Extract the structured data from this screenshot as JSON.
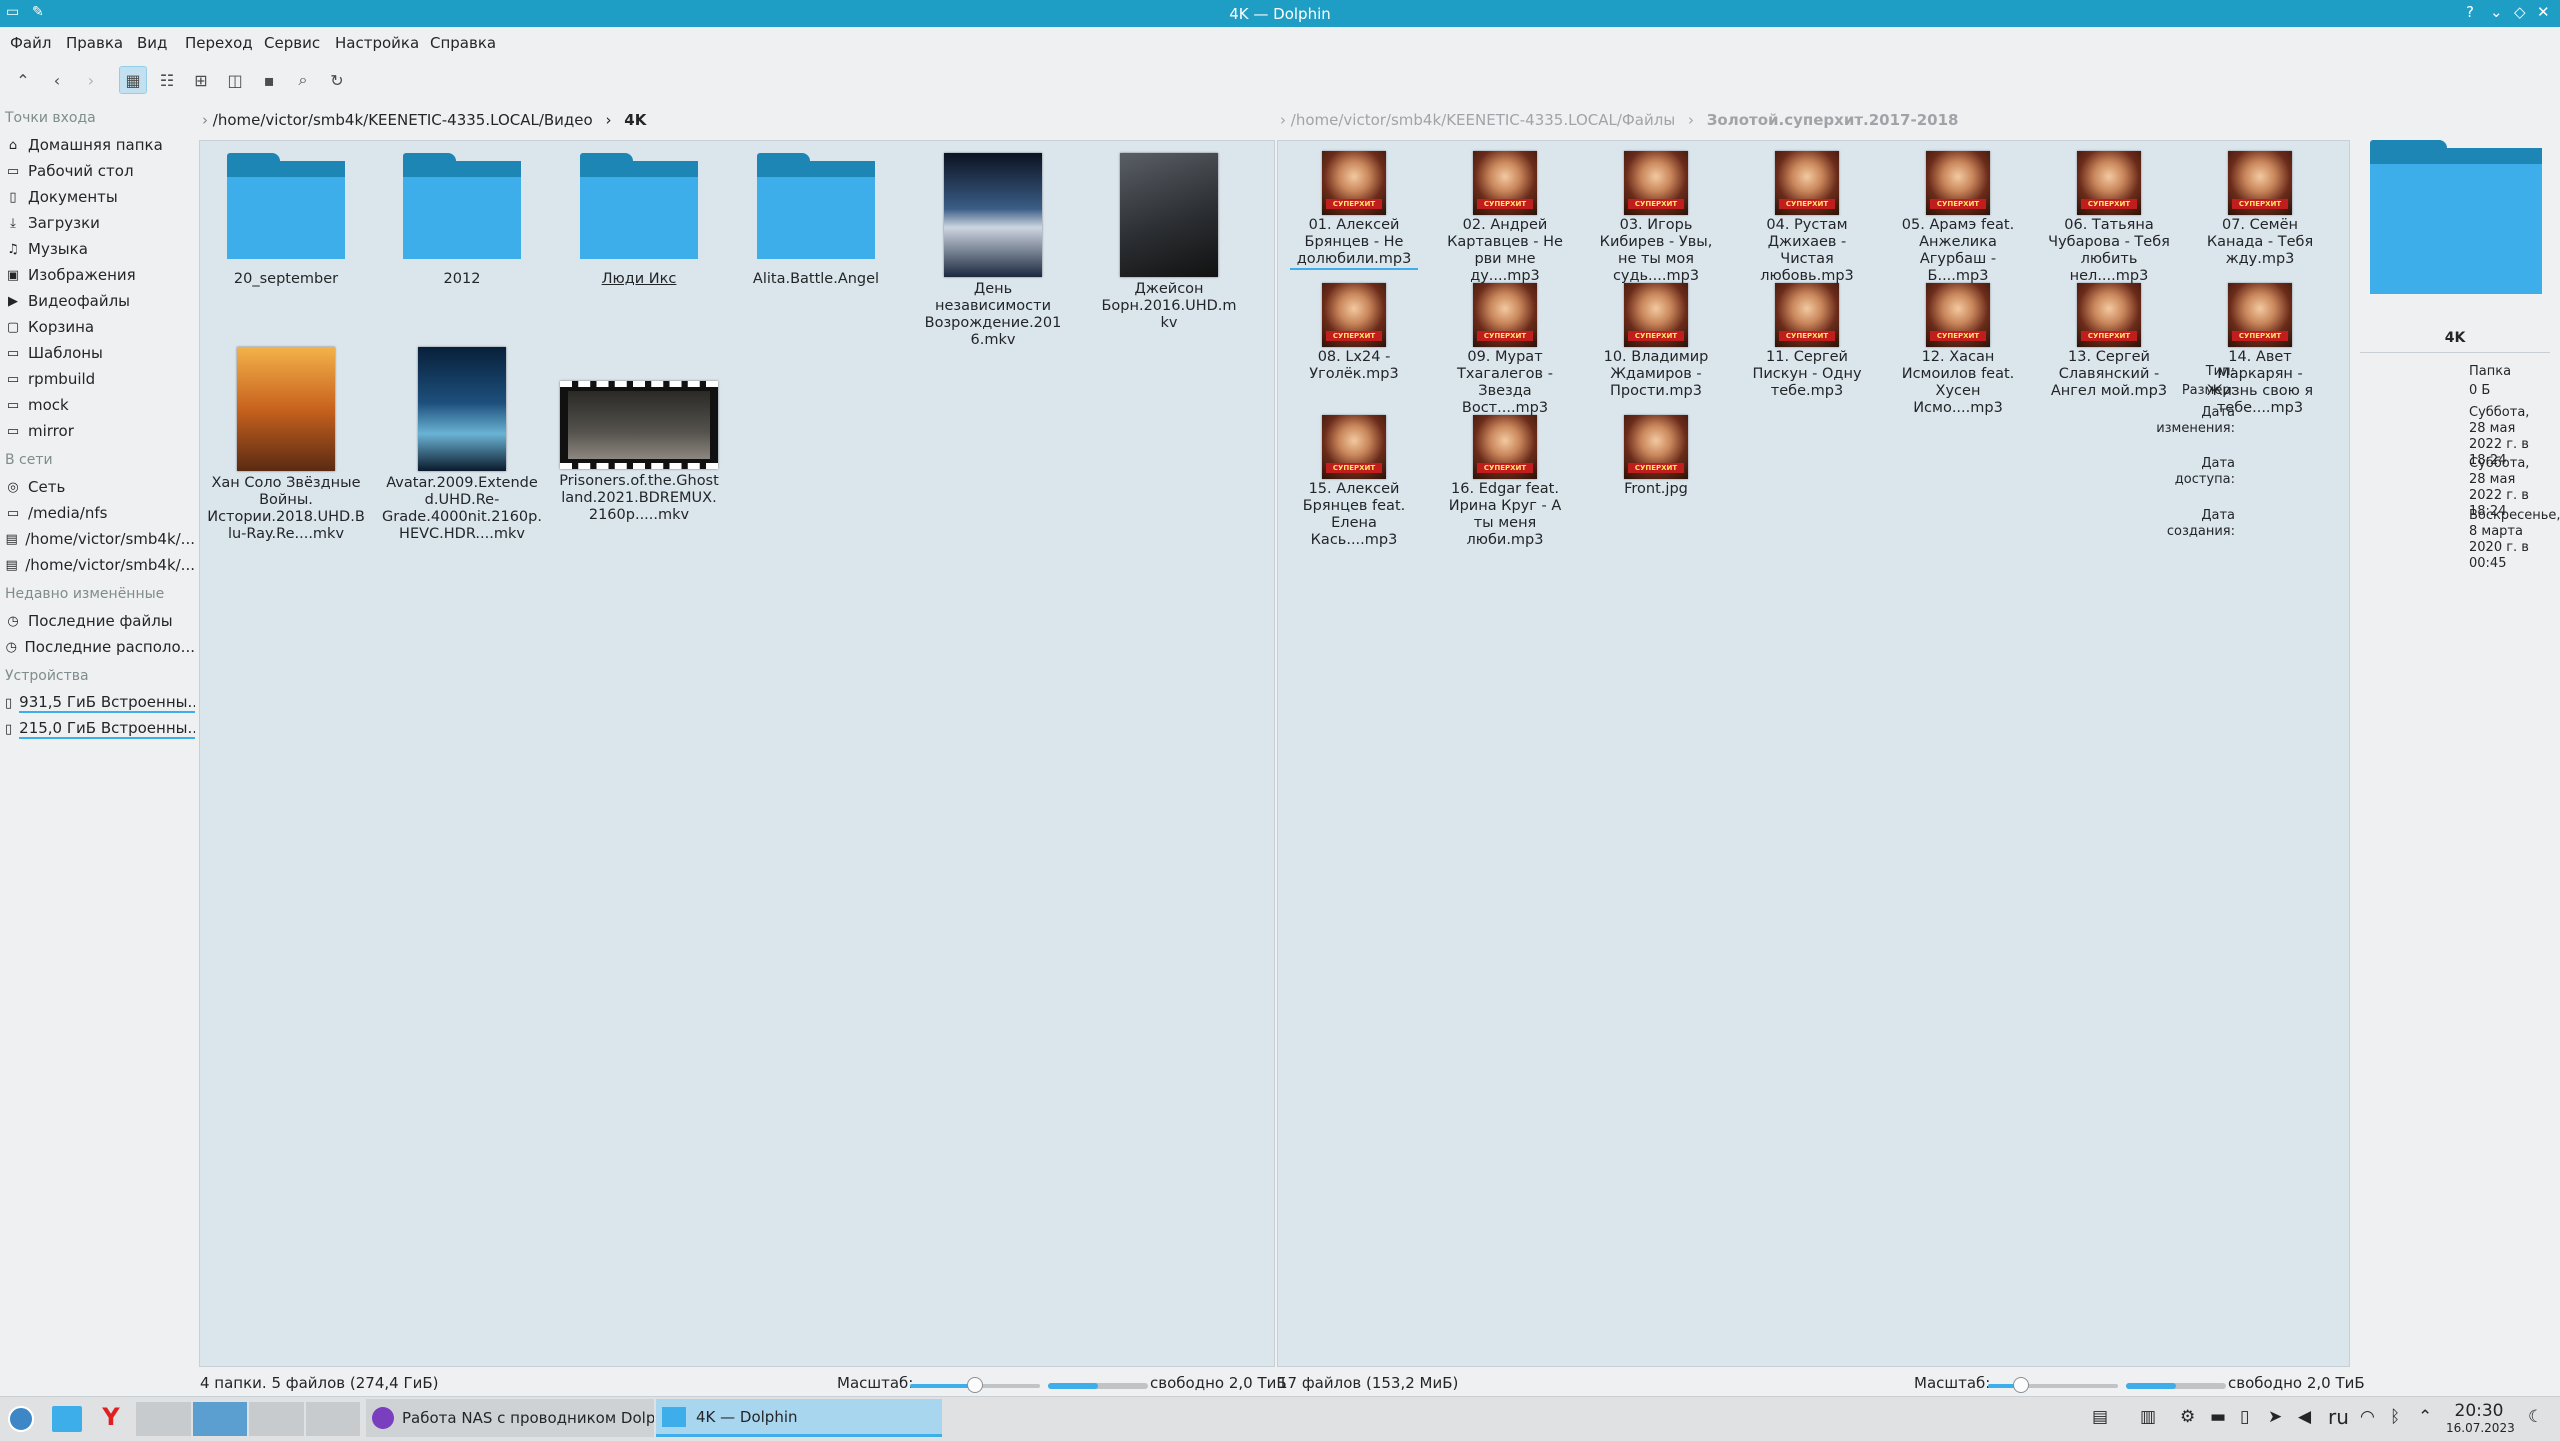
{
  "window": {
    "title": "4K — Dolphin"
  },
  "menu": [
    "Файл",
    "Правка",
    "Вид",
    "Переход",
    "Сервис",
    "Настройка",
    "Справка"
  ],
  "toolbar": {
    "icons": [
      "up-arrow-icon",
      "back-arrow-icon",
      "forward-arrow-icon",
      "icons-view-icon",
      "details-view-icon",
      "compact-view-icon",
      "split-view-icon",
      "terminal-icon",
      "search-icon",
      "refresh-icon"
    ]
  },
  "places": {
    "sections": [
      {
        "title": "Точки входа",
        "items": [
          "Домашняя папка",
          "Рабочий стол",
          "Документы",
          "Загрузки",
          "Музыка",
          "Изображения",
          "Видеофайлы",
          "Корзина",
          "Шаблоны",
          "rpmbuild",
          "mock",
          "mirror"
        ]
      },
      {
        "title": "В сети",
        "items": [
          "Сеть",
          "/media/nfs",
          "/home/victor/smb4k/...",
          "/home/victor/smb4k/..."
        ]
      },
      {
        "title": "Недавно изменённые",
        "items": [
          "Последние файлы",
          "Последние располо..."
        ]
      },
      {
        "title": "Устройства",
        "items": [
          "931,5 ГиБ Встроенны...",
          "215,0 ГиБ Встроенны..."
        ]
      }
    ]
  },
  "left_pane": {
    "breadcrumb": {
      "path": "/home/victor/smb4k/KEENETIC-4335.LOCAL/Видео",
      "sep": "›",
      "current": "4K"
    },
    "items": [
      {
        "label": "20_september",
        "kind": "folder"
      },
      {
        "label": "2012",
        "kind": "folder"
      },
      {
        "label": "Люди Икс",
        "kind": "folder"
      },
      {
        "label": "Alita.Battle.Angel",
        "kind": "folder"
      },
      {
        "label": "День независимости Возрождение.2016.mkv",
        "kind": "poster",
        "color": "#3a5d86"
      },
      {
        "label": "Джейсон Борн.2016.UHD.mkv",
        "kind": "poster",
        "color": "#2c2f33"
      },
      {
        "label": "Хан Соло Звёздные Войны. Истории.2018.UHD.Blu-Ray.Re....mkv",
        "kind": "poster",
        "color": "#c8621e"
      },
      {
        "label": "Avatar.2009.Extended.UHD.Re-Grade.4000nit.2160p.HEVC.HDR....mkv",
        "kind": "poster",
        "color": "#1d4f7c"
      },
      {
        "label": "Prisoners.of.the.Ghostland.2021.BDREMUX.2160p.....mkv",
        "kind": "film",
        "color": "#55524d"
      }
    ],
    "status": "4 папки. 5 файлов (274,4 ГиБ)",
    "zoom_label": "Масштаб:",
    "zoom": 0.5,
    "free_used": 0.5,
    "free_text": "свободно 2,0 ТиБ"
  },
  "right_pane": {
    "breadcrumb": {
      "path": "/home/victor/smb4k/KEENETIC-4335.LOCAL/Файлы",
      "sep": "›",
      "current": "Золотой.суперхит.2017-2018"
    },
    "items": [
      "01. Алексей Брянцев - Не долюбили.mp3",
      "02. Андрей Картавцев - Не рви мне ду....mp3",
      "03. Игорь Кибирев - Увы, не ты моя судь....mp3",
      "04. Рустам Джихаев - Чистая любовь.mp3",
      "05. Арамэ feat. Анжелика Агурбаш - Б....mp3",
      "06. Татьяна Чубарова - Тебя любить нел....mp3",
      "07. Семён Канада - Тебя жду.mp3",
      "08. Lx24 - Уголёк.mp3",
      "09. Мурат Тхагалегов - Звезда Вост....mp3",
      "10. Владимир Ждамиров - Прости.mp3",
      "11. Сергей Пискун - Одну тебе.mp3",
      "12. Хасан Исмоилов feat. Хусен Исмо....mp3",
      "13. Сергей Славянский - Ангел мой.mp3",
      "14. Авет Маркарян - Жизнь свою я тебе....mp3",
      "15. Алексей Брянцев feat. Елена Кась....mp3",
      "16. Edgar feat. Ирина Круг - А ты меня люби.mp3",
      "Front.jpg"
    ],
    "cover_text": "СУПЕРХИТ",
    "status": "17 файлов (153,2 МиБ)",
    "zoom_label": "Масштаб:",
    "zoom": 0.25,
    "free_used": 0.5,
    "free_text": "свободно 2,0 ТиБ"
  },
  "info_panel": {
    "name": "4K",
    "rows": [
      {
        "k": "Тип:",
        "v": "Папка"
      },
      {
        "k": "Размер:",
        "v": "0 Б"
      },
      {
        "k": "Дата изменения:",
        "v": "Суббота, 28 мая 2022 г. в 18:24"
      },
      {
        "k": "Дата доступа:",
        "v": "Суббота, 28 мая 2022 г. в 18:24"
      },
      {
        "k": "Дата создания:",
        "v": "Воскресенье, 8 марта 2020 г. в 00:45"
      }
    ]
  },
  "taskbar": {
    "tasks": [
      {
        "label": "Работа NAS с проводником Dolp..."
      },
      {
        "label": "4K — Dolphin"
      }
    ],
    "lang": "ru",
    "time": "20:30",
    "date": "16.07.2023"
  },
  "colors": {
    "accent": "#3daee9",
    "titlebar": "#1e9ec4",
    "pane_bg": "#dbe5ec"
  }
}
